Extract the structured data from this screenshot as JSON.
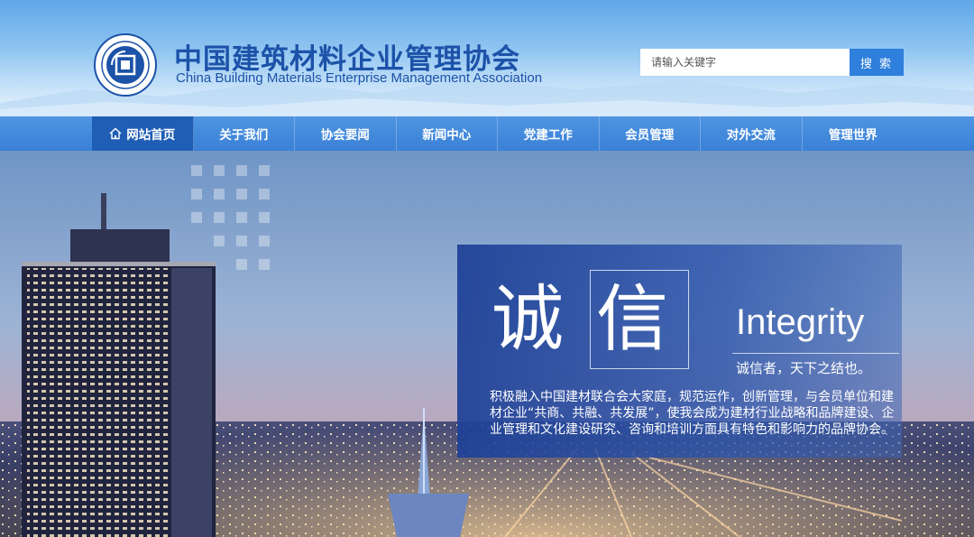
{
  "header": {
    "title_cn": "中国建筑材料企业管理协会",
    "title_en": "China Building Materials Enterprise Management Association",
    "emblem_icon": "association-seal-emblem"
  },
  "search": {
    "placeholder": "请输入关键字",
    "button_label": "搜 索"
  },
  "nav": {
    "items": [
      {
        "label": "网站首页",
        "icon": "home-icon",
        "active": true
      },
      {
        "label": "关于我们"
      },
      {
        "label": "协会要闻"
      },
      {
        "label": "新闻中心"
      },
      {
        "label": "党建工作"
      },
      {
        "label": "会员管理"
      },
      {
        "label": "对外交流"
      },
      {
        "label": "管理世界"
      }
    ]
  },
  "hero": {
    "char_1": "诚",
    "char_2": "信",
    "en_word": "Integrity",
    "subtitle": "诚信者，天下之结也。",
    "body": "积极融入中国建材联合会大家庭，规范运作，创新管理，与会员单位和建材企业“共商、共融、共发展”，使我会成为建材行业战略和品牌建设、企业管理和文化建设研究、咨询和培训方面具有特色和影响力的品牌协会。"
  },
  "colors": {
    "brand_blue": "#1c52a8",
    "nav_blue": "#3a80d6",
    "nav_active": "#1f5eb5",
    "search_button": "#2f7fdc"
  }
}
